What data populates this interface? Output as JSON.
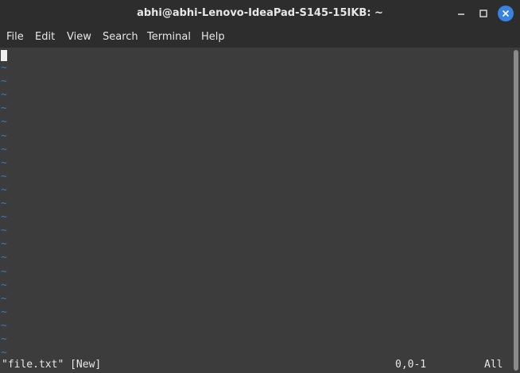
{
  "window": {
    "title": "abhi@abhi-Lenovo-IdeaPad-S145-15IKB: ~",
    "minimize_icon": "minimize-icon",
    "maximize_icon": "maximize-icon",
    "close_icon": "close-icon",
    "accent_color": "#3584e4"
  },
  "menu": {
    "items": [
      "File",
      "Edit",
      "View",
      "Search",
      "Terminal",
      "Help"
    ]
  },
  "editor": {
    "empty_line_marker": "~",
    "marker_color": "#3c78b8",
    "status_file": "\"file.txt\" [New]",
    "status_position": "0,0-1",
    "status_scroll": "All"
  }
}
